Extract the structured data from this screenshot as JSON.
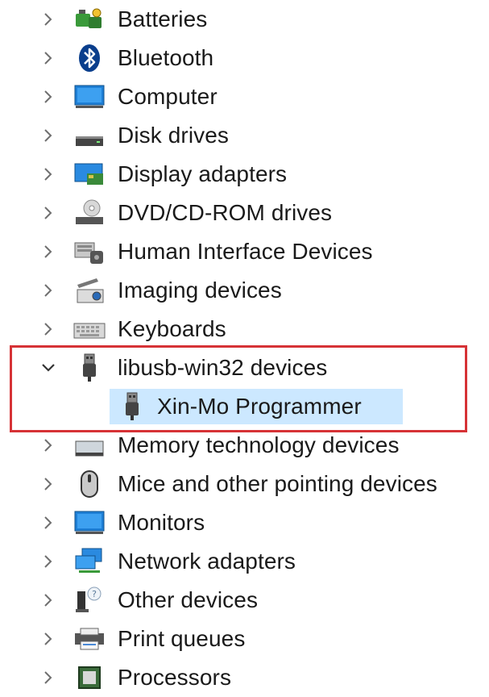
{
  "colors": {
    "selection_bg": "#cce8ff",
    "highlight_border": "#d63236",
    "chevron": "#6f6f6f",
    "text": "#1a1a1a"
  },
  "tree": {
    "items": [
      {
        "label": "Batteries",
        "icon": "battery-icon",
        "expanded": false
      },
      {
        "label": "Bluetooth",
        "icon": "bluetooth-icon",
        "expanded": false
      },
      {
        "label": "Computer",
        "icon": "computer-icon",
        "expanded": false
      },
      {
        "label": "Disk drives",
        "icon": "disk-drive-icon",
        "expanded": false
      },
      {
        "label": "Display adapters",
        "icon": "display-adapter-icon",
        "expanded": false
      },
      {
        "label": "DVD/CD-ROM drives",
        "icon": "dvd-drive-icon",
        "expanded": false
      },
      {
        "label": "Human Interface Devices",
        "icon": "hid-icon",
        "expanded": false
      },
      {
        "label": "Imaging devices",
        "icon": "imaging-device-icon",
        "expanded": false
      },
      {
        "label": "Keyboards",
        "icon": "keyboard-icon",
        "expanded": false
      },
      {
        "label": "libusb-win32 devices",
        "icon": "usb-plug-icon",
        "expanded": true
      },
      {
        "label": "Xin-Mo Programmer",
        "icon": "usb-plug-icon",
        "child": true,
        "selected": true
      },
      {
        "label": "Memory technology devices",
        "icon": "memory-device-icon",
        "expanded": false
      },
      {
        "label": "Mice and other pointing devices",
        "icon": "mouse-icon",
        "expanded": false
      },
      {
        "label": "Monitors",
        "icon": "monitor-icon",
        "expanded": false
      },
      {
        "label": "Network adapters",
        "icon": "network-adapter-icon",
        "expanded": false
      },
      {
        "label": "Other devices",
        "icon": "other-device-icon",
        "expanded": false
      },
      {
        "label": "Print queues",
        "icon": "printer-icon",
        "expanded": false
      },
      {
        "label": "Processors",
        "icon": "processor-icon",
        "expanded": false
      }
    ]
  }
}
